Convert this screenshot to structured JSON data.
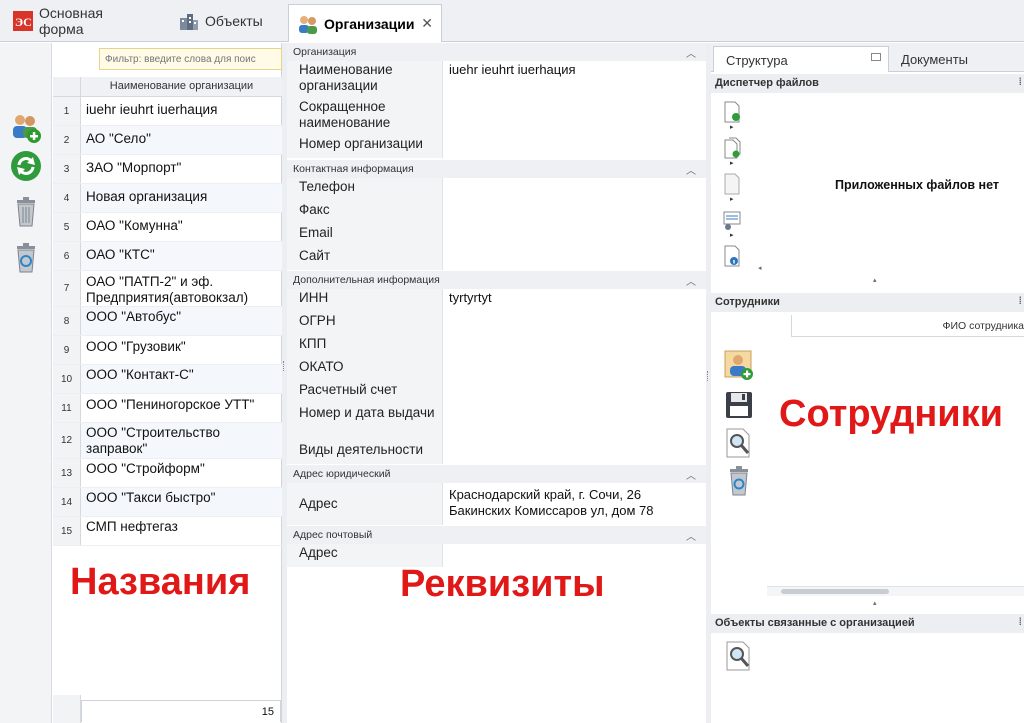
{
  "tabs": [
    {
      "label": "Основная форма"
    },
    {
      "label": "Объекты"
    },
    {
      "label": "Организации",
      "close": "✕"
    }
  ],
  "filter": {
    "placeholder": "Фильтр: введите слова для поис"
  },
  "org_list": {
    "column_header": "Наименование организации",
    "rows": [
      {
        "num": "1",
        "name": "iuehr ieuhrt iuerhaция"
      },
      {
        "num": "2",
        "name": "АО \"Село\""
      },
      {
        "num": "3",
        "name": "ЗАО \"Морпорт\""
      },
      {
        "num": "4",
        "name": "Новая организация"
      },
      {
        "num": "5",
        "name": "ОАО \"Комунна\""
      },
      {
        "num": "6",
        "name": "ОАО \"КТС\""
      },
      {
        "num": "7",
        "name": "ОАО \"ПАТП-2\" и эф. Предприятия(автовокзал)"
      },
      {
        "num": "8",
        "name": "ООО \"Автобус\""
      },
      {
        "num": "9",
        "name": "ООО \"Грузовик\""
      },
      {
        "num": "10",
        "name": "ООО \"Контакт-С\""
      },
      {
        "num": "11",
        "name": "ООО \"Пениногорское УТТ\""
      },
      {
        "num": "12",
        "name": "ООО \"Строительство заправок\""
      },
      {
        "num": "13",
        "name": "ООО \"Стройформ\""
      },
      {
        "num": "14",
        "name": "ООО \"Такси быстро\""
      },
      {
        "num": "15",
        "name": "СМП нефтегаз"
      }
    ],
    "count": "15",
    "overlay_label": "Названия"
  },
  "details": {
    "overlay_label": "Реквизиты",
    "sections": [
      {
        "title": "Организация",
        "fields": [
          {
            "label": "Наименование организации",
            "value": "iuehr ieuhrt iuerhaция"
          },
          {
            "label": "Сокращенное наименование",
            "value": ""
          },
          {
            "label": "Номер организации",
            "value": ""
          }
        ]
      },
      {
        "title": "Контактная информация",
        "fields": [
          {
            "label": "Телефон",
            "value": ""
          },
          {
            "label": "Факс",
            "value": ""
          },
          {
            "label": "Email",
            "value": ""
          },
          {
            "label": "Сайт",
            "value": ""
          }
        ]
      },
      {
        "title": "Дополнительная информация",
        "fields": [
          {
            "label": "ИНН",
            "value": "tyrtyrtyt"
          },
          {
            "label": "ОГРН",
            "value": ""
          },
          {
            "label": "КПП",
            "value": ""
          },
          {
            "label": "ОКАТО",
            "value": ""
          },
          {
            "label": "Расчетный счет",
            "value": ""
          },
          {
            "label": "Номер и дата выдачи",
            "value": ""
          },
          {
            "label": "Виды деятельности",
            "value": ""
          }
        ]
      },
      {
        "title": "Адрес юридический",
        "fields": [
          {
            "label": "Адрес",
            "value": "Краснодарский край, г. Сочи, 26 Бакинских Комиссаров ул, дом 78"
          }
        ]
      },
      {
        "title": "Адрес почтовый",
        "fields": [
          {
            "label": "Адрес",
            "value": ""
          }
        ]
      }
    ]
  },
  "right_panel": {
    "tabs": [
      {
        "label": "Структура"
      },
      {
        "label": "Документы"
      }
    ],
    "file_manager": {
      "title": "Диспетчер файлов",
      "empty_text": "Приложенных файлов нет"
    },
    "employees": {
      "title": "Сотрудники",
      "column_header": "ФИО сотрудника",
      "overlay_label": "Сотрудники"
    },
    "linked_objects": {
      "title": "Объекты связанные с организацией"
    }
  },
  "colors": {
    "accent_red": "#e01818",
    "header_bg": "#eef0f4"
  }
}
